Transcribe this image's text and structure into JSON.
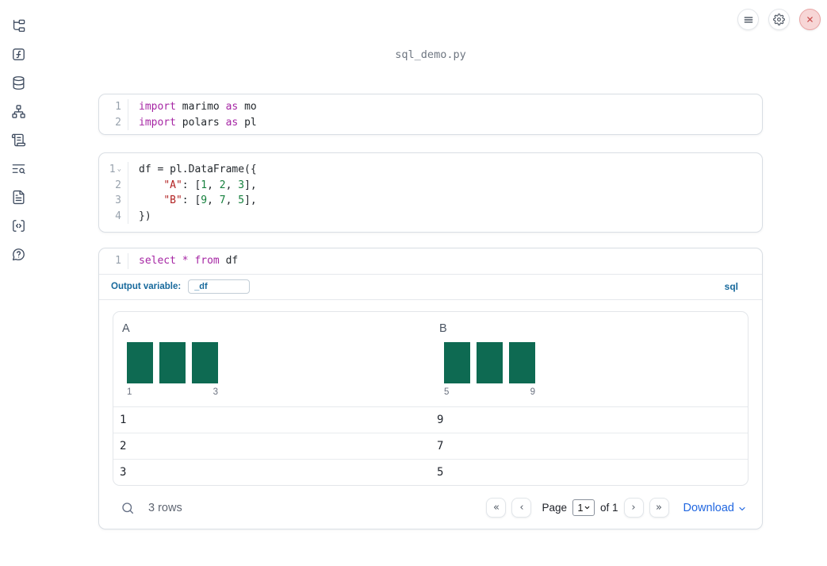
{
  "app": {
    "title": "sql_demo.py"
  },
  "sidebar": {
    "icons": [
      {
        "name": "file-tree"
      },
      {
        "name": "function-square"
      },
      {
        "name": "database"
      },
      {
        "name": "network"
      },
      {
        "name": "scroll-text"
      },
      {
        "name": "list-search"
      },
      {
        "name": "file-text"
      },
      {
        "name": "code-square"
      },
      {
        "name": "help-bubble"
      }
    ]
  },
  "topbar": {
    "buttons": [
      {
        "name": "menu"
      },
      {
        "name": "settings"
      },
      {
        "name": "close"
      }
    ]
  },
  "cells": [
    {
      "kind": "python",
      "fold_chevron_line": null,
      "lines": [
        [
          [
            "kw",
            "import"
          ],
          [
            "pl",
            " marimo "
          ],
          [
            "kw",
            "as"
          ],
          [
            "pl",
            " mo"
          ]
        ],
        [
          [
            "kw",
            "import"
          ],
          [
            "pl",
            " polars "
          ],
          [
            "kw",
            "as"
          ],
          [
            "pl",
            " pl"
          ]
        ]
      ]
    },
    {
      "kind": "python",
      "fold_chevron_line": 1,
      "lines": [
        [
          [
            "pl",
            "df = pl.DataFrame({"
          ]
        ],
        [
          [
            "pl",
            "    "
          ],
          [
            "str",
            "\"A\""
          ],
          [
            "pl",
            ": ["
          ],
          [
            "num",
            "1"
          ],
          [
            "pl",
            ", "
          ],
          [
            "num",
            "2"
          ],
          [
            "pl",
            ", "
          ],
          [
            "num",
            "3"
          ],
          [
            "pl",
            "],"
          ]
        ],
        [
          [
            "pl",
            "    "
          ],
          [
            "str",
            "\"B\""
          ],
          [
            "pl",
            ": ["
          ],
          [
            "num",
            "9"
          ],
          [
            "pl",
            ", "
          ],
          [
            "num",
            "7"
          ],
          [
            "pl",
            ", "
          ],
          [
            "num",
            "5"
          ],
          [
            "pl",
            "],"
          ]
        ],
        [
          [
            "pl",
            "})"
          ]
        ]
      ]
    },
    {
      "kind": "sql",
      "fold_chevron_line": null,
      "lines": [
        [
          [
            "kw",
            "select"
          ],
          [
            "pl",
            " "
          ],
          [
            "kw",
            "*"
          ],
          [
            "pl",
            " "
          ],
          [
            "kw",
            "from"
          ],
          [
            "pl",
            " df"
          ]
        ]
      ]
    }
  ],
  "sql_meta": {
    "output_variable_label": "Output variable:",
    "output_variable_value": "_df",
    "language_badge": "sql"
  },
  "table": {
    "columns": [
      {
        "name": "A",
        "hist": {
          "bar_count": 3,
          "min_label": "1",
          "max_label": "3"
        }
      },
      {
        "name": "B",
        "hist": {
          "bar_count": 3,
          "min_label": "5",
          "max_label": "9"
        }
      }
    ],
    "rows": [
      [
        "1",
        "9"
      ],
      [
        "2",
        "7"
      ],
      [
        "3",
        "5"
      ]
    ],
    "row_count_text": "3 rows",
    "pagination": {
      "first": "«",
      "prev": "‹",
      "page_label": "Page",
      "page_value": "1",
      "of_label": "of 1",
      "next": "›",
      "last": "»"
    },
    "download_label": "Download"
  },
  "colors": {
    "accent_blue": "#2167e0",
    "label_blue": "#17699c",
    "histogram_bar": "#0e6a52",
    "keyword": "#a626a4",
    "string": "#b22222",
    "number": "#15803d"
  }
}
